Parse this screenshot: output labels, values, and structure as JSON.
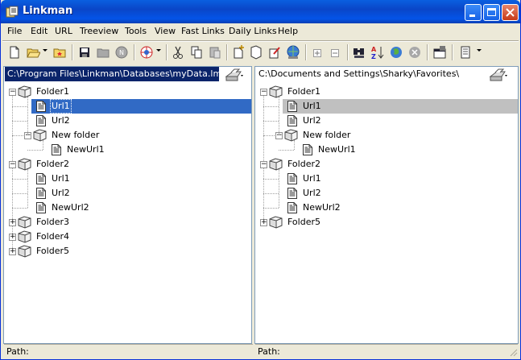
{
  "window": {
    "title": "Linkman"
  },
  "menu": [
    "File",
    "Edit",
    "URL",
    "Treeview",
    "Tools",
    "View",
    "Fast Links",
    "Daily Links",
    "Help"
  ],
  "toolbar": {
    "icons": [
      "new-icon",
      "open-icon",
      "favorites-icon",
      "save-icon",
      "folder-icon",
      "navigator-icon",
      "browser-icon",
      "cut-icon",
      "copy-icon",
      "paste-icon",
      "add-url-icon",
      "add-folder-icon",
      "edit-icon",
      "check-icon",
      "expand-icon",
      "collapse-icon",
      "find-icon",
      "sort-icon",
      "globe-icon",
      "stop-icon",
      "properties-icon",
      "report-icon"
    ]
  },
  "left_pane": {
    "path": "C:\\Program Files\\Linkman\\Databases\\myData.lmd",
    "tree": [
      {
        "label": "Folder1",
        "type": "folder",
        "level": 0,
        "expander": "minus"
      },
      {
        "label": "Url1",
        "type": "url",
        "level": 1,
        "selected": true
      },
      {
        "label": "Url2",
        "type": "url",
        "level": 1
      },
      {
        "label": "New folder",
        "type": "folder",
        "level": 1,
        "expander": "minus"
      },
      {
        "label": "NewUrl1",
        "type": "url",
        "level": 2
      },
      {
        "label": "Folder2",
        "type": "folder",
        "level": 0,
        "expander": "minus"
      },
      {
        "label": "Url1",
        "type": "url",
        "level": 1
      },
      {
        "label": "Url2",
        "type": "url",
        "level": 1
      },
      {
        "label": "NewUrl2",
        "type": "url",
        "level": 1
      },
      {
        "label": "Folder3",
        "type": "folder",
        "level": 0,
        "expander": "plus"
      },
      {
        "label": "Folder4",
        "type": "folder",
        "level": 0,
        "expander": "plus"
      },
      {
        "label": "Folder5",
        "type": "folder",
        "level": 0,
        "expander": "plus"
      }
    ]
  },
  "right_pane": {
    "path": "C:\\Documents and Settings\\Sharky\\Favorites\\",
    "tree": [
      {
        "label": "Folder1",
        "type": "folder",
        "level": 0,
        "expander": "minus"
      },
      {
        "label": "Url1",
        "type": "url",
        "level": 1,
        "selected": true
      },
      {
        "label": "Url2",
        "type": "url",
        "level": 1
      },
      {
        "label": "New folder",
        "type": "folder",
        "level": 1,
        "expander": "minus"
      },
      {
        "label": "NewUrl1",
        "type": "url",
        "level": 2
      },
      {
        "label": "Folder2",
        "type": "folder",
        "level": 0,
        "expander": "minus"
      },
      {
        "label": "Url1",
        "type": "url",
        "level": 1
      },
      {
        "label": "Url2",
        "type": "url",
        "level": 1
      },
      {
        "label": "NewUrl2",
        "type": "url",
        "level": 1
      },
      {
        "label": "Folder5",
        "type": "folder",
        "level": 0,
        "expander": "plus"
      }
    ]
  },
  "status": {
    "left": "Path:",
    "right": "Path:"
  },
  "colors": {
    "title_bar": "#0a5fe0",
    "selection_active": "#316ac5",
    "selection_inactive": "#c0c0c0",
    "path_active_bg": "#0a246a"
  }
}
